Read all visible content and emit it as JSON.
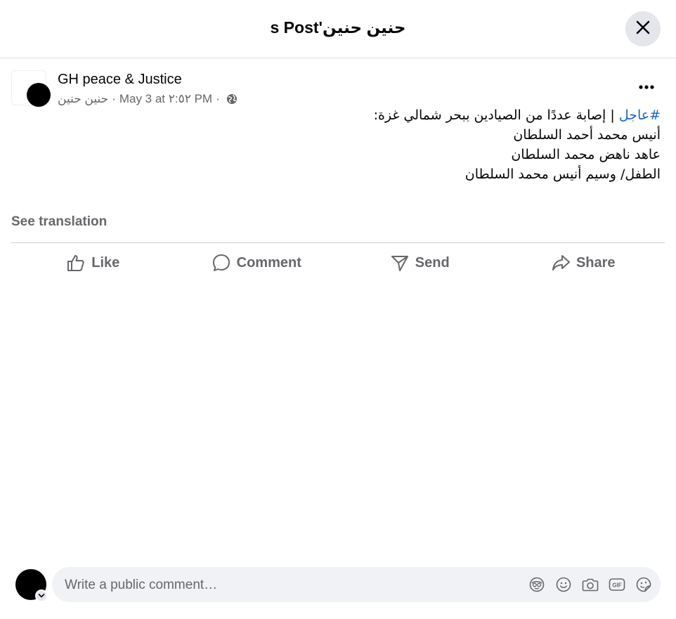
{
  "dialog": {
    "title": "حنين حنين's Post"
  },
  "post": {
    "author": "GH peace & Justice",
    "meta": {
      "poster": "حنين حنين",
      "date": "May 3 at ٢:٥٢ PM",
      "sep": "·",
      "privacy_icon": "globe-icon"
    },
    "hashtag": "#عاجل",
    "first_line_rest": " | إصابة عددًا من الصيادين ببحر شمالي غزة:",
    "lines": [
      "أنيس محمد أحمد السلطان",
      "عاهد ناهض محمد السلطان",
      "الطفل/ وسيم أنيس محمد السلطان"
    ],
    "see_translation": "See translation"
  },
  "actions": {
    "like": "Like",
    "comment": "Comment",
    "send": "Send",
    "share": "Share"
  },
  "composer": {
    "placeholder": "Write a public comment…",
    "tools": [
      "avatar-sticker-icon",
      "emoji-icon",
      "camera-icon",
      "gif-icon",
      "sticker-icon"
    ]
  },
  "colors": {
    "hashtag": "#1a64cc",
    "secondary_text": "#65676b",
    "input_bg": "#f0f2f5",
    "close_bg": "#e4e6eb"
  }
}
